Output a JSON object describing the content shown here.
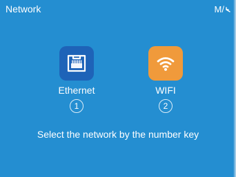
{
  "header": {
    "title": "Network",
    "back_key_label": "M/",
    "back_key_icon": "return-arrow-icon"
  },
  "options": [
    {
      "label": "Ethernet",
      "number": "1",
      "icon": "ethernet-port-icon",
      "color": "#1e63b8"
    },
    {
      "label": "WIFI",
      "number": "2",
      "icon": "wifi-icon",
      "color": "#f09a3b"
    }
  ],
  "instruction": "Select the network by the number key",
  "theme": {
    "background": "#248ed1",
    "text": "#ffffff"
  }
}
